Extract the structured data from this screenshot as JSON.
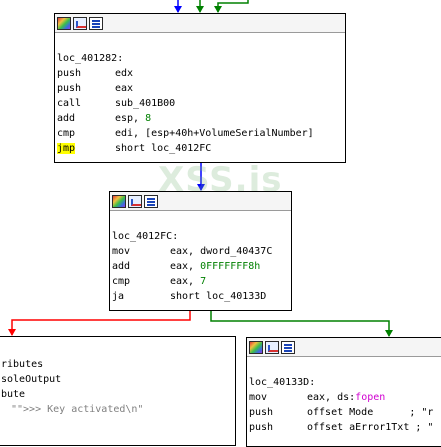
{
  "colors": {
    "edge_true": "#008000",
    "edge_false": "#ff0000",
    "edge_flow": "#0000ff"
  },
  "watermark": "XSS.is",
  "node1": {
    "toolbar": [
      "color-icon",
      "graph-icon",
      "xref-icon"
    ],
    "label": "loc_401282:",
    "lines": [
      {
        "mn": "push",
        "op": "edx"
      },
      {
        "mn": "push",
        "op": "eax"
      },
      {
        "mn": "call",
        "op": "sub_401B00"
      },
      {
        "mn": "add",
        "op_a": "esp, ",
        "op_num": "8"
      },
      {
        "mn": "cmp",
        "op": "edi, [esp+40h+VolumeSerialNumber]"
      },
      {
        "mn": "jmp",
        "op": "short loc_4012FC"
      }
    ]
  },
  "node2": {
    "label": "loc_4012FC:",
    "lines": [
      {
        "mn": "mov",
        "op": "eax, dword_40437C"
      },
      {
        "mn": "add",
        "op_a": "eax, ",
        "op_num": "0FFFFFFF8h"
      },
      {
        "mn": "cmp",
        "op_a": "eax, ",
        "op_num": "7"
      },
      {
        "mn": "ja",
        "op": "short loc_40133D"
      }
    ]
  },
  "node3": {
    "lines": [
      {
        "text": "ributes"
      },
      {
        "text": "soleOutput"
      },
      {
        "text": "bute"
      },
      {
        "text": "\"\">>> Key activated\\n\""
      }
    ]
  },
  "node4": {
    "label": "loc_40133D:",
    "lines": [
      {
        "mn": "mov",
        "op_a": "eax, ds:",
        "op_fn": "fopen"
      },
      {
        "mn": "push",
        "op": "offset Mode      ; \"r"
      },
      {
        "mn": "push",
        "op": "offset aError1Txt ; \""
      }
    ]
  }
}
